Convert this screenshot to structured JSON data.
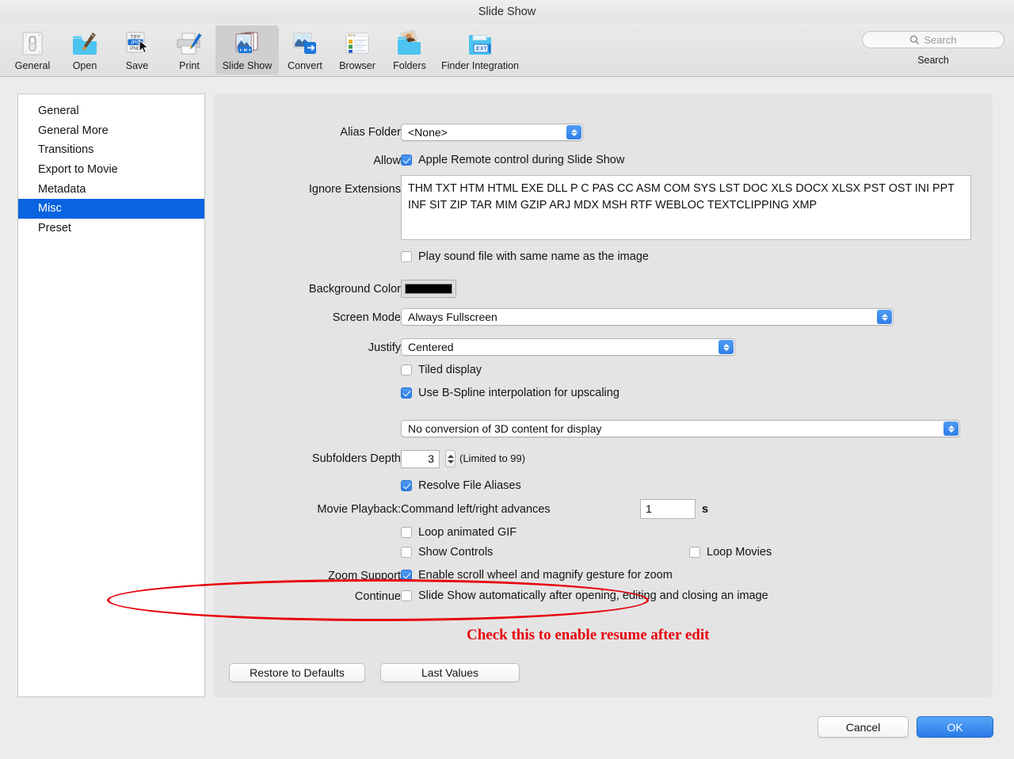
{
  "window": {
    "title": "Slide Show"
  },
  "toolbar": {
    "items": [
      {
        "label": "General",
        "icon": "general-switch-icon"
      },
      {
        "label": "Open",
        "icon": "open-folder-brush-icon"
      },
      {
        "label": "Save",
        "icon": "save-formats-icon"
      },
      {
        "label": "Print",
        "icon": "printer-icon"
      },
      {
        "label": "Slide Show",
        "icon": "slideshow-icon",
        "selected": true
      },
      {
        "label": "Convert",
        "icon": "convert-icon"
      },
      {
        "label": "Browser",
        "icon": "browser-list-icon"
      },
      {
        "label": "Folders",
        "icon": "folders-photo-icon"
      },
      {
        "label": "Finder Integration",
        "icon": "finder-integration-ext-icon"
      }
    ],
    "search": {
      "placeholder": "Search",
      "icon": "search-icon",
      "caption": "Search"
    }
  },
  "sidebar": {
    "items": [
      {
        "label": "General"
      },
      {
        "label": "General More"
      },
      {
        "label": "Transitions"
      },
      {
        "label": "Export to Movie"
      },
      {
        "label": "Metadata"
      },
      {
        "label": "Misc",
        "selected": true
      },
      {
        "label": "Preset"
      }
    ]
  },
  "form": {
    "alias_folder": {
      "label": "Alias Folder:",
      "value": "<None>"
    },
    "allow": {
      "label": "Allow:",
      "checkbox_label": "Apple Remote control during Slide Show",
      "checked": true
    },
    "ignore_extensions": {
      "label": "Ignore Extensions:",
      "value": "THM TXT HTM HTML EXE DLL P C PAS CC ASM COM SYS LST DOC XLS DOCX XLSX PST OST INI PPT INF SIT ZIP TAR MIM GZIP ARJ MDX MSH RTF WEBLOC TEXTCLIPPING XMP"
    },
    "play_sound": {
      "checkbox_label": "Play sound file with same name as the image",
      "checked": false
    },
    "background_color": {
      "label": "Background Color:",
      "value": "#000000"
    },
    "screen_mode": {
      "label": "Screen Mode:",
      "value": "Always Fullscreen"
    },
    "justify": {
      "label": "Justify:",
      "value": "Centered"
    },
    "tiled_display": {
      "checkbox_label": "Tiled display",
      "checked": false
    },
    "bspline": {
      "checkbox_label": "Use B-Spline interpolation for upscaling",
      "checked": true
    },
    "conversion_3d": {
      "value": "No conversion of 3D content for display"
    },
    "subfolders_depth": {
      "label": "Subfolders Depth:",
      "value": "3",
      "hint": "(Limited to 99)"
    },
    "resolve_aliases": {
      "checkbox_label": "Resolve File Aliases",
      "checked": true
    },
    "movie_playback": {
      "label": "Movie Playback:",
      "text": "Command left/right advances",
      "seconds_value": "1",
      "seconds_unit": "s"
    },
    "loop_gif": {
      "checkbox_label": "Loop animated GIF",
      "checked": false
    },
    "show_controls": {
      "checkbox_label": "Show Controls",
      "checked": false
    },
    "loop_movies": {
      "checkbox_label": "Loop Movies",
      "checked": false
    },
    "zoom_support": {
      "label": "Zoom Support:",
      "checkbox_label": "Enable scroll wheel and magnify gesture for zoom",
      "checked": true
    },
    "continue": {
      "label": "Continue:",
      "checkbox_label": "Slide Show automatically after opening, editing and closing an image",
      "checked": false
    }
  },
  "annotation": {
    "text": "Check this to enable resume after edit",
    "color": "#e8000b"
  },
  "buttons": {
    "restore_defaults": "Restore to Defaults",
    "last_values": "Last Values",
    "cancel": "Cancel",
    "ok": "OK"
  }
}
